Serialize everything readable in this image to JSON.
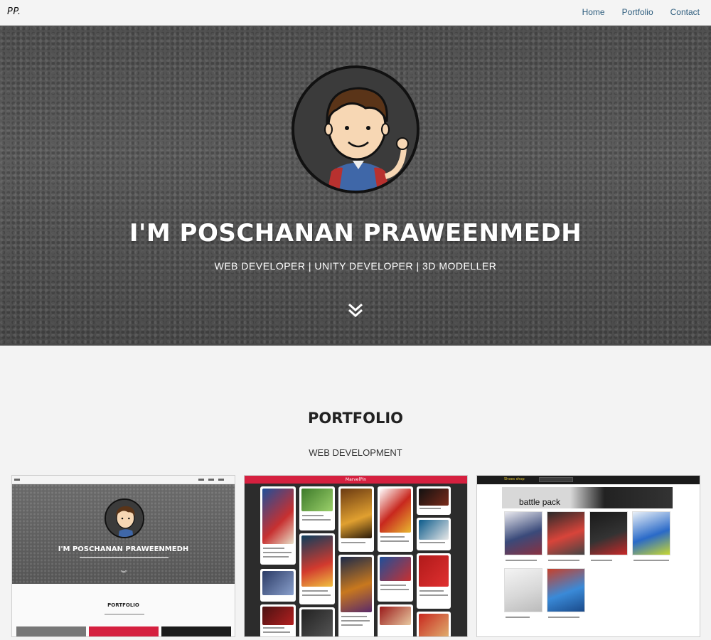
{
  "nav": {
    "brand": "PP.",
    "links": [
      "Home",
      "Portfolio",
      "Contact"
    ]
  },
  "hero": {
    "title": "I'M POSCHANAN PRAWEENMEDH",
    "subtitle": "WEB DEVELOPER | UNITY DEVELOPER | 3D MODELLER",
    "scroll_icon": "chevron-double-down-icon"
  },
  "portfolio": {
    "title": "PORTFOLIO",
    "category": "WEB DEVELOPMENT",
    "cards": [
      {
        "mini_title": "I'M POSCHANAN PRAWEENMEDH",
        "mini_section": "PORTFOLIO"
      },
      {
        "mini_bar": "MarvelPin"
      },
      {
        "mini_banner": "battle pack",
        "mini_logo": "Shoes shop"
      }
    ]
  },
  "colors": {
    "nav_link": "#2f5e7e",
    "marvel_bar": "#d5203f",
    "background": "#f3f3f3"
  }
}
